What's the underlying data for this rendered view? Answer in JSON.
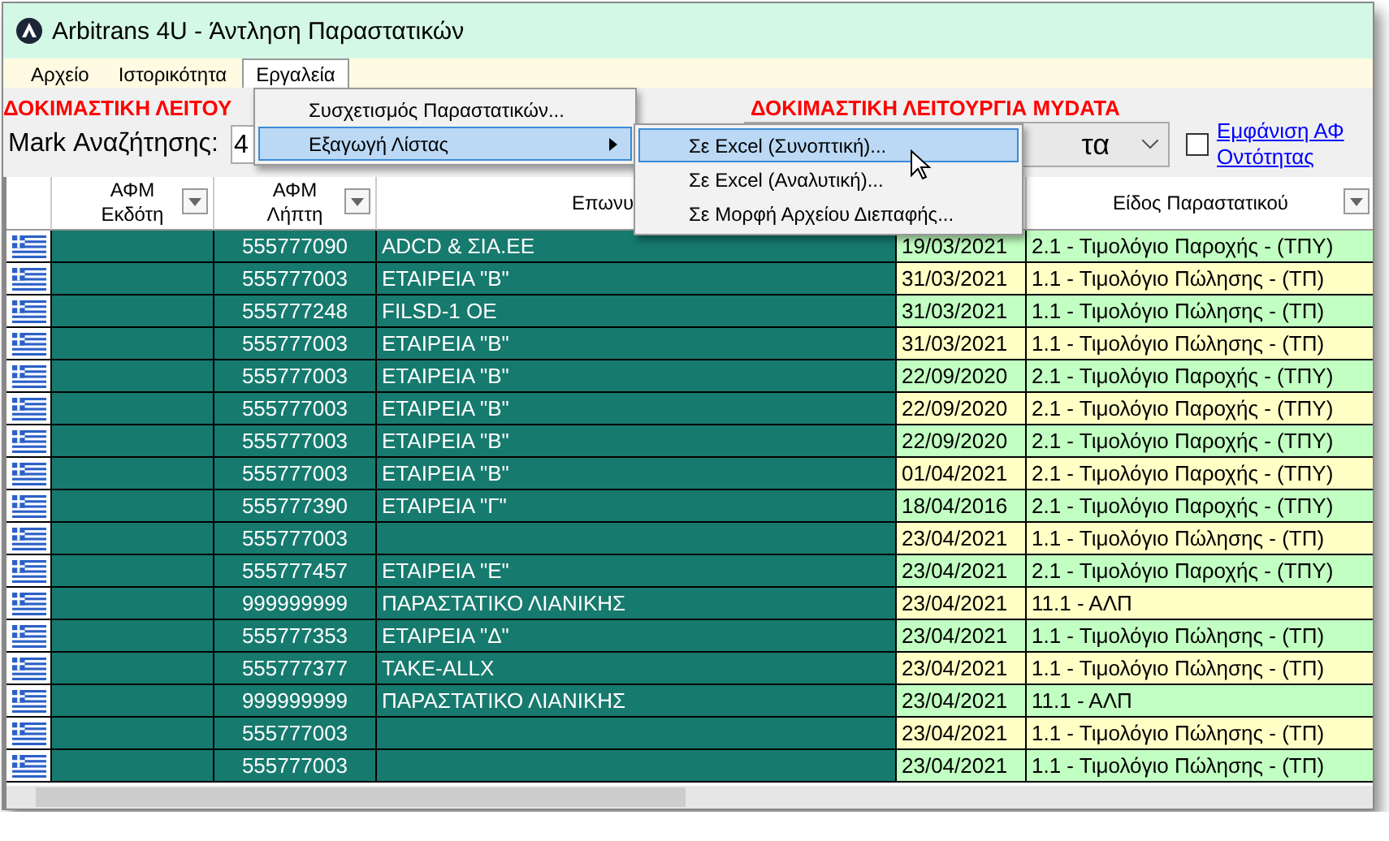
{
  "window": {
    "title": "Arbitrans 4U - Άντληση Παραστατικών"
  },
  "menu": [
    {
      "label": "Αρχείο",
      "selected": false
    },
    {
      "label": "Ιστορικότητα",
      "selected": false
    },
    {
      "label": "Εργαλεία",
      "selected": true
    }
  ],
  "dropdown": [
    {
      "label": "Συσχετισμός Παραστατικών...",
      "selected": false,
      "submenu": false
    },
    {
      "label": "Εξαγωγή Λίστας",
      "selected": true,
      "submenu": true
    }
  ],
  "submenu": [
    {
      "label": "Σε Excel (Συνοπτική)...",
      "selected": true
    },
    {
      "label": "Σε Excel (Αναλυτική)...",
      "selected": false
    },
    {
      "label": "Σε Μορφή Αρχείου Διεπαφής...",
      "selected": false
    }
  ],
  "warnings": [
    "ΔΟΚΙΜΑΣΤΙΚΗ ΛΕΙΤΟΥ",
    "ΔΟΚΙΜΑΣΤΙΚΗ ΛΕΙΤΟΥΡΓΙΑ MYDATA"
  ],
  "search": {
    "label": "Mark Αναζήτησης:",
    "value": "4"
  },
  "combo": {
    "value": "τα"
  },
  "show_vat": {
    "checked": false,
    "label_lines": [
      "Εμφάνιση ΑΦ",
      "Οντότητας"
    ]
  },
  "table": {
    "columns": [
      {
        "filter": false
      },
      {
        "label": "ΑΦΜ Εκδότη",
        "filter": true
      },
      {
        "label": "ΑΦΜ Λήπτη",
        "filter": true
      },
      {
        "label": "Επωνυ"
      },
      {},
      {
        "label": "Είδος Παραστατικού",
        "filter": true
      }
    ],
    "rows": [
      {
        "receiver_vat": "555777090",
        "name": "ADCD & ΣΙΑ.ΕΕ",
        "date": "19/03/2021",
        "type": "2.1 - Τιμολόγιο Παροχής - (ΤΠΥ)"
      },
      {
        "receiver_vat": "555777003",
        "name": "ΕΤΑΙΡΕΙΑ \"Β\"",
        "date": "31/03/2021",
        "type": "1.1 - Τιμολόγιο Πώλησης - (ΤΠ)"
      },
      {
        "receiver_vat": "555777248",
        "name": "FILSD-1 OE",
        "date": "31/03/2021",
        "type": "1.1 - Τιμολόγιο Πώλησης - (ΤΠ)"
      },
      {
        "receiver_vat": "555777003",
        "name": "ΕΤΑΙΡΕΙΑ \"Β\"",
        "date": "31/03/2021",
        "type": "1.1 - Τιμολόγιο Πώλησης - (ΤΠ)"
      },
      {
        "receiver_vat": "555777003",
        "name": "ΕΤΑΙΡΕΙΑ \"Β\"",
        "date": "22/09/2020",
        "type": "2.1 - Τιμολόγιο Παροχής - (ΤΠΥ)"
      },
      {
        "receiver_vat": "555777003",
        "name": "ΕΤΑΙΡΕΙΑ \"Β\"",
        "date": "22/09/2020",
        "type": "2.1 - Τιμολόγιο Παροχής - (ΤΠΥ)"
      },
      {
        "receiver_vat": "555777003",
        "name": "ΕΤΑΙΡΕΙΑ \"Β\"",
        "date": "22/09/2020",
        "type": "2.1 - Τιμολόγιο Παροχής - (ΤΠΥ)"
      },
      {
        "receiver_vat": "555777003",
        "name": "ΕΤΑΙΡΕΙΑ \"Β\"",
        "date": "01/04/2021",
        "type": "2.1 - Τιμολόγιο Παροχής - (ΤΠΥ)"
      },
      {
        "receiver_vat": "555777390",
        "name": "ΕΤΑΙΡΕΙΑ \"Γ\"",
        "date": "18/04/2016",
        "type": "2.1 - Τιμολόγιο Παροχής - (ΤΠΥ)"
      },
      {
        "receiver_vat": "555777003",
        "date": "23/04/2021",
        "type": "1.1 - Τιμολόγιο Πώλησης - (ΤΠ)"
      },
      {
        "receiver_vat": "555777457",
        "name": "ΕΤΑΙΡΕΙΑ \"Ε\"",
        "date": "23/04/2021",
        "type": "2.1 - Τιμολόγιο Παροχής - (ΤΠΥ)"
      },
      {
        "receiver_vat": "999999999",
        "name": "ΠΑΡΑΣΤΑΤΙΚΟ ΛΙΑΝΙΚΗΣ",
        "date": "23/04/2021",
        "type": "11.1 - ΑΛΠ"
      },
      {
        "receiver_vat": "555777353",
        "name": "ΕΤΑΙΡΕΙΑ \"Δ\"",
        "date": "23/04/2021",
        "type": "1.1 - Τιμολόγιο Πώλησης - (ΤΠ)"
      },
      {
        "receiver_vat": "555777377",
        "name": "TAKE-ALLX",
        "date": "23/04/2021",
        "type": "1.1 - Τιμολόγιο Πώλησης - (ΤΠ)"
      },
      {
        "receiver_vat": "999999999",
        "name": "ΠΑΡΑΣΤΑΤΙΚΟ ΛΙΑΝΙΚΗΣ",
        "date": "23/04/2021",
        "type": "11.1 - ΑΛΠ"
      },
      {
        "receiver_vat": "555777003",
        "date": "23/04/2021",
        "type": "1.1 - Τιμολόγιο Πώλησης - (ΤΠ)"
      },
      {
        "receiver_vat": "555777003",
        "date": "23/04/2021",
        "type": "1.1 - Τιμολόγιο Πώλησης - (ΤΠ)"
      }
    ]
  }
}
